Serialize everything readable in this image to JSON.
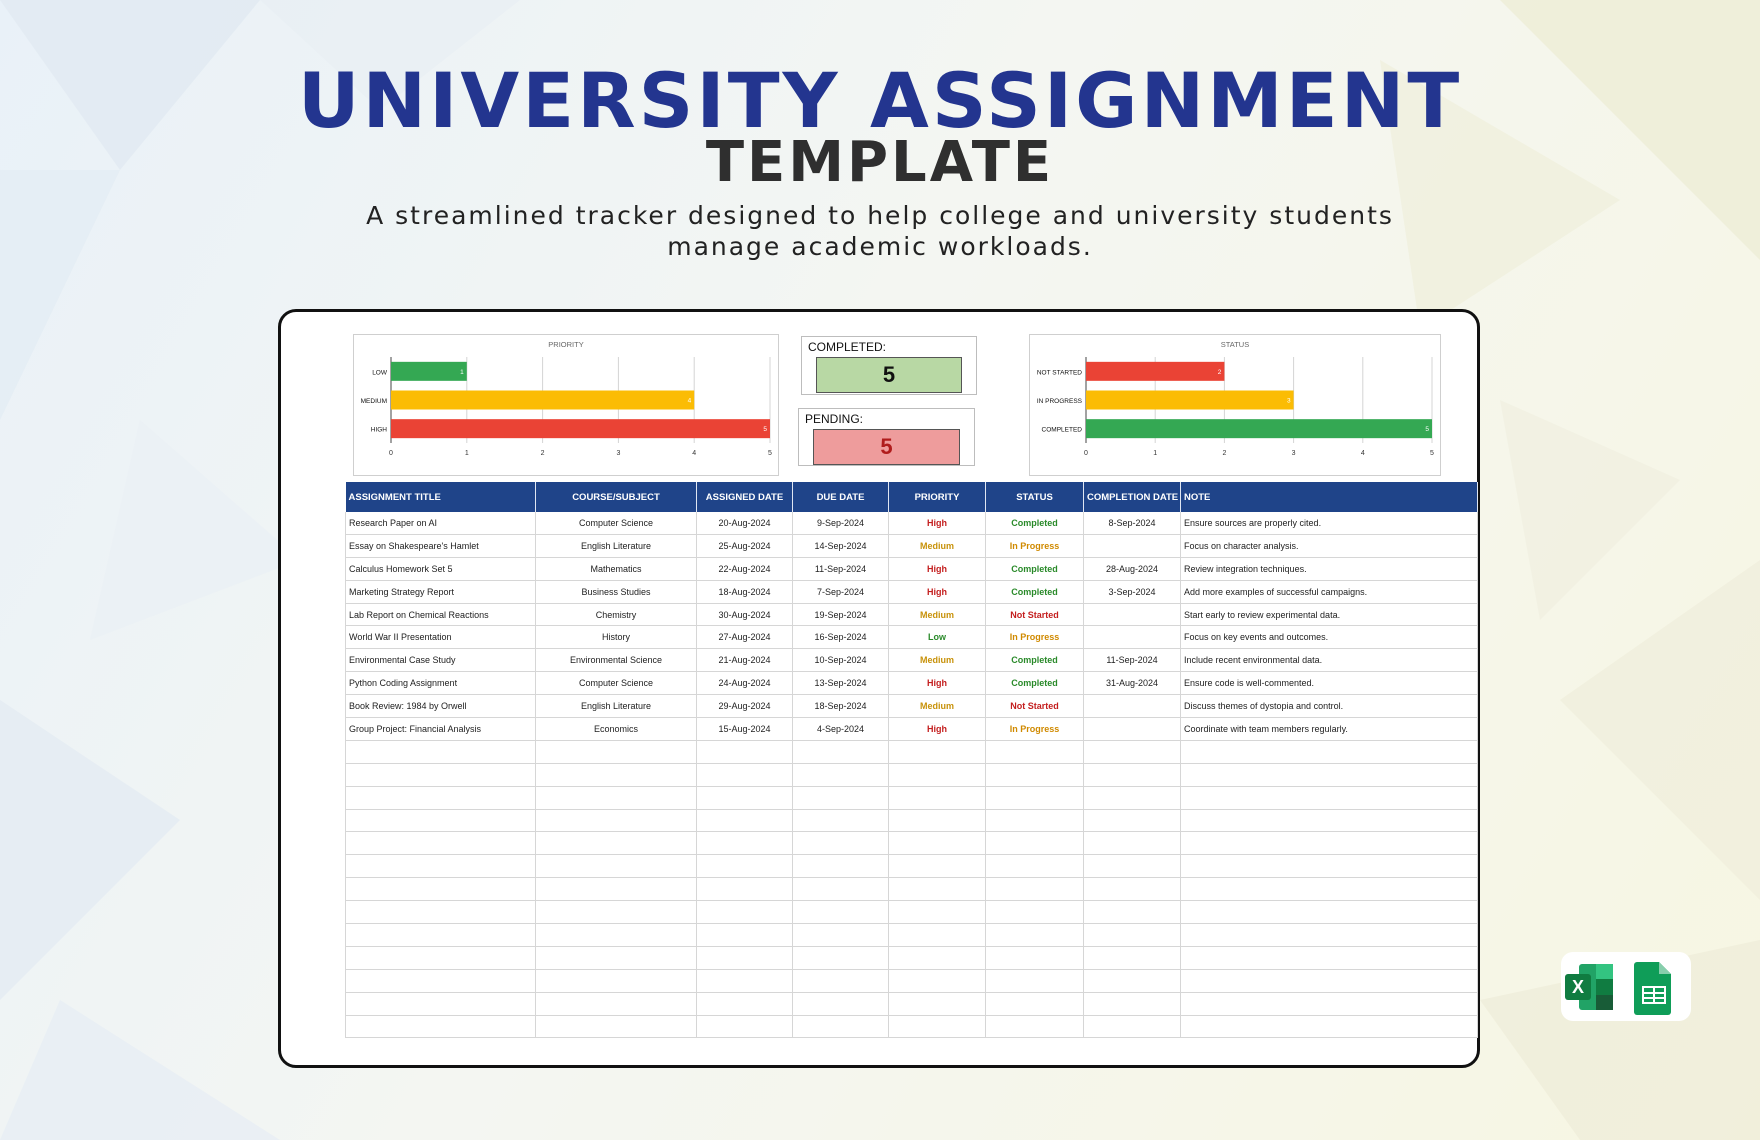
{
  "hero": {
    "title": "UNIVERSITY ASSIGNMENT",
    "subtitle": "TEMPLATE",
    "tagline": "A streamlined tracker designed to help college and university students manage academic workloads."
  },
  "colors": {
    "title": "#23358f",
    "header_bg": "#1f4489",
    "bar_green": "#34a853",
    "bar_yellow": "#fbbc04",
    "bar_red": "#ea4335",
    "completed_bg": "#b8d8a4",
    "pending_bg": "#ee9c9c"
  },
  "kpis": {
    "completed": {
      "label": "COMPLETED:",
      "value": "5"
    },
    "pending": {
      "label": "PENDING:",
      "value": "5"
    }
  },
  "chart_data": [
    {
      "type": "bar",
      "orientation": "horizontal",
      "title": "PRIORITY",
      "categories": [
        "LOW",
        "MEDIUM",
        "HIGH"
      ],
      "values": [
        1,
        4,
        5
      ],
      "colors": [
        "#34a853",
        "#fbbc04",
        "#ea4335"
      ],
      "xlim": [
        0,
        5
      ],
      "xticks": [
        0,
        1,
        2,
        3,
        4,
        5
      ],
      "grid": true
    },
    {
      "type": "bar",
      "orientation": "horizontal",
      "title": "STATUS",
      "categories": [
        "NOT STARTED",
        "IN PROGRESS",
        "COMPLETED"
      ],
      "values": [
        2,
        3,
        5
      ],
      "colors": [
        "#ea4335",
        "#fbbc04",
        "#34a853"
      ],
      "xlim": [
        0,
        5
      ],
      "xticks": [
        0,
        1,
        2,
        3,
        4,
        5
      ],
      "grid": true
    }
  ],
  "table": {
    "columns": [
      "ASSIGNMENT TITLE",
      "COURSE/SUBJECT",
      "ASSIGNED DATE",
      "DUE DATE",
      "PRIORITY",
      "STATUS",
      "COMPLETION DATE",
      "NOTE"
    ],
    "rows": [
      [
        "Research Paper on AI",
        "Computer Science",
        "20-Aug-2024",
        "9-Sep-2024",
        "High",
        "Completed",
        "8-Sep-2024",
        "Ensure sources are properly cited."
      ],
      [
        "Essay on Shakespeare's Hamlet",
        "English Literature",
        "25-Aug-2024",
        "14-Sep-2024",
        "Medium",
        "In Progress",
        "",
        "Focus on character analysis."
      ],
      [
        "Calculus Homework Set 5",
        "Mathematics",
        "22-Aug-2024",
        "11-Sep-2024",
        "High",
        "Completed",
        "28-Aug-2024",
        "Review integration techniques."
      ],
      [
        "Marketing Strategy Report",
        "Business Studies",
        "18-Aug-2024",
        "7-Sep-2024",
        "High",
        "Completed",
        "3-Sep-2024",
        "Add more examples of successful campaigns."
      ],
      [
        "Lab Report on Chemical Reactions",
        "Chemistry",
        "30-Aug-2024",
        "19-Sep-2024",
        "Medium",
        "Not Started",
        "",
        "Start early to review experimental data."
      ],
      [
        "World War II Presentation",
        "History",
        "27-Aug-2024",
        "16-Sep-2024",
        "Low",
        "In Progress",
        "",
        "Focus on key events and outcomes."
      ],
      [
        "Environmental Case Study",
        "Environmental Science",
        "21-Aug-2024",
        "10-Sep-2024",
        "Medium",
        "Completed",
        "11-Sep-2024",
        "Include recent environmental data."
      ],
      [
        "Python Coding Assignment",
        "Computer Science",
        "24-Aug-2024",
        "13-Sep-2024",
        "High",
        "Completed",
        "31-Aug-2024",
        "Ensure code is well-commented."
      ],
      [
        "Book Review: 1984 by Orwell",
        "English Literature",
        "29-Aug-2024",
        "18-Sep-2024",
        "Medium",
        "Not Started",
        "",
        "Discuss themes of dystopia and control."
      ],
      [
        "Group Project: Financial Analysis",
        "Economics",
        "15-Aug-2024",
        "4-Sep-2024",
        "High",
        "In Progress",
        "",
        "Coordinate with team members regularly."
      ]
    ],
    "empty_rows": 13
  },
  "badges": {
    "excel_icon": "excel-icon",
    "sheets_icon": "google-sheets-icon",
    "excel_letter": "X"
  }
}
